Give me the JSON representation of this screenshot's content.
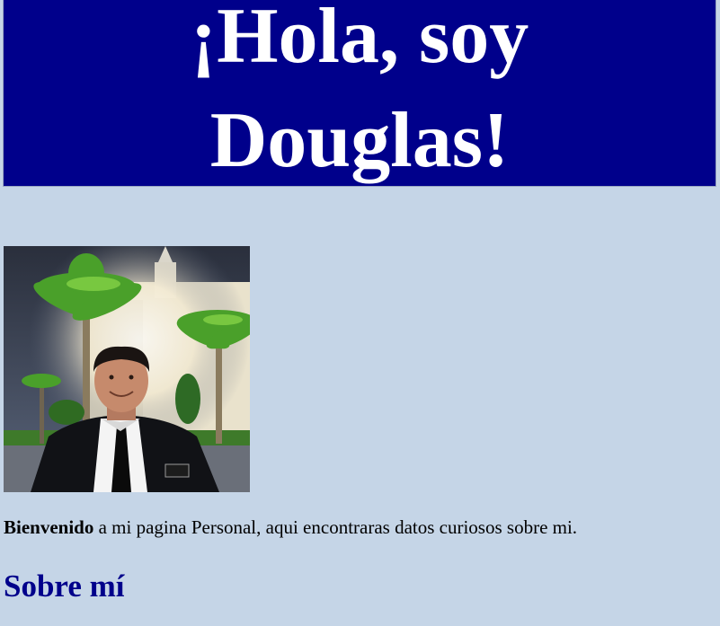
{
  "header": {
    "title": "¡Hola, soy Douglas!"
  },
  "profile_photo": {
    "alt": "Douglas frente a un templo con palmeras"
  },
  "intro": {
    "bold": "Bienvenido",
    "rest": " a mi pagina Personal, aqui encontraras datos curiosos sobre mi."
  },
  "sections": {
    "about_title": "Sobre mí"
  },
  "colors": {
    "banner_background": "#00008b",
    "page_background": "#c5d5e7",
    "heading_color": "#00008b"
  }
}
